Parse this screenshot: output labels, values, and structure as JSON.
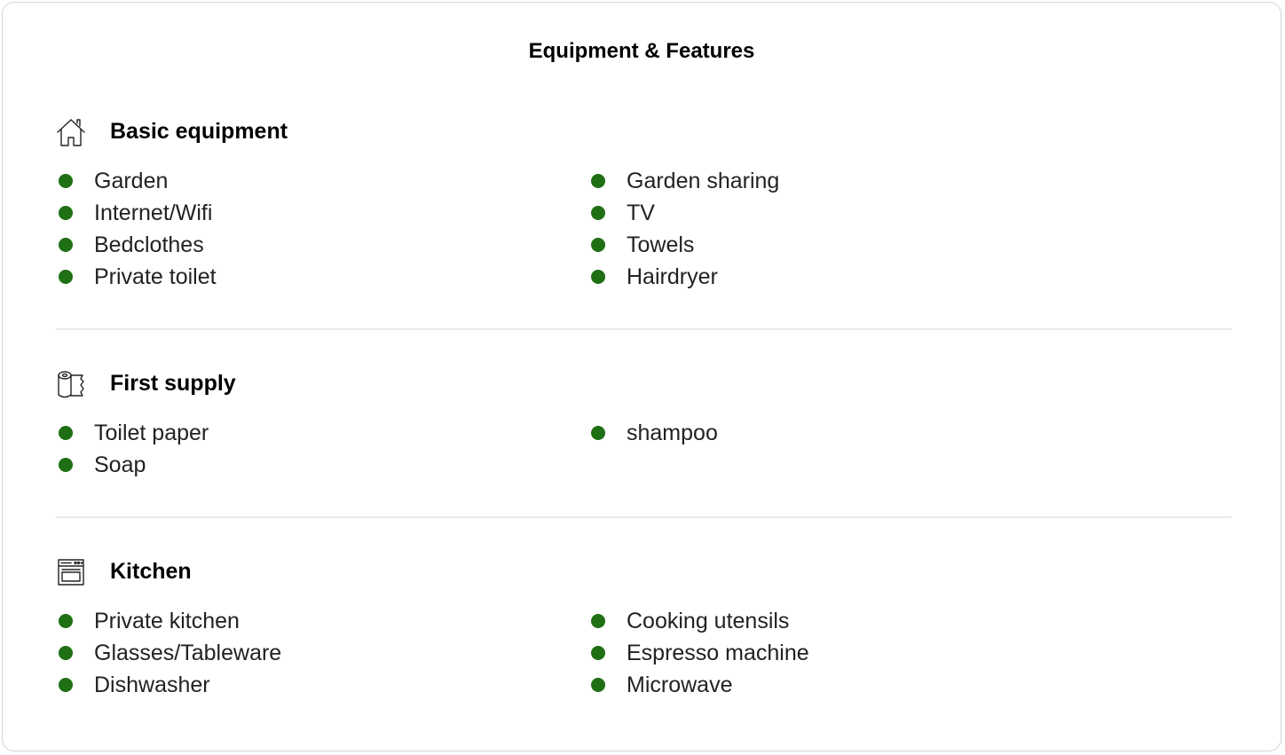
{
  "page_title": "Equipment & Features",
  "colors": {
    "bullet": "#1f6f14",
    "divider": "#ebebeb",
    "border": "#d4d4d4"
  },
  "sections": [
    {
      "title": "Basic equipment",
      "icon": "house-icon",
      "left_items": [
        "Garden",
        "Internet/Wifi",
        "Bedclothes",
        "Private toilet"
      ],
      "right_items": [
        "Garden sharing",
        "TV",
        "Towels",
        "Hairdryer"
      ]
    },
    {
      "title": "First supply",
      "icon": "toilet-paper-icon",
      "left_items": [
        "Toilet paper",
        "Soap"
      ],
      "right_items": [
        "shampoo"
      ]
    },
    {
      "title": "Kitchen",
      "icon": "oven-icon",
      "left_items": [
        "Private kitchen",
        "Glasses/Tableware",
        "Dishwasher"
      ],
      "right_items": [
        "Cooking utensils",
        "Espresso machine",
        "Microwave"
      ]
    }
  ]
}
